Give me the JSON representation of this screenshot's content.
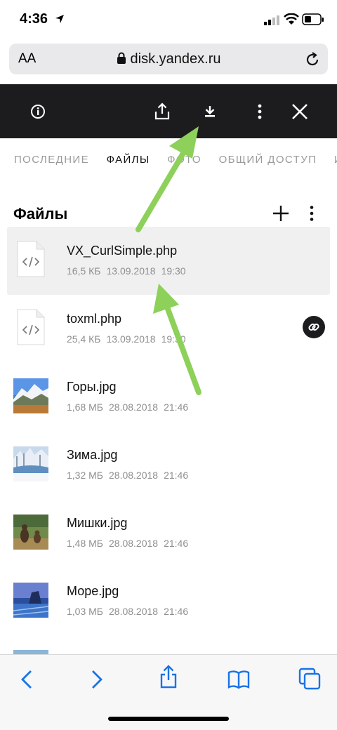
{
  "status": {
    "time": "4:36"
  },
  "browser": {
    "aa_label": "AA",
    "domain": "disk.yandex.ru"
  },
  "tabs": [
    "ПОСЛЕДНИЕ",
    "ФАЙЛЫ",
    "ФОТО",
    "ОБЩИЙ ДОСТУП",
    "И"
  ],
  "section": {
    "title": "Файлы"
  },
  "files": [
    {
      "name": "VX_CurlSimple.php",
      "size": "16,5 КБ",
      "date": "13.09.2018",
      "time": "19:30"
    },
    {
      "name": "toxml.php",
      "size": "25,4 КБ",
      "date": "13.09.2018",
      "time": "19:30"
    },
    {
      "name": "Горы.jpg",
      "size": "1,68 МБ",
      "date": "28.08.2018",
      "time": "21:46"
    },
    {
      "name": "Зима.jpg",
      "size": "1,32 МБ",
      "date": "28.08.2018",
      "time": "21:46"
    },
    {
      "name": "Мишки.jpg",
      "size": "1,48 МБ",
      "date": "28.08.2018",
      "time": "21:46"
    },
    {
      "name": "Море.jpg",
      "size": "1,03 МБ",
      "date": "28.08.2018",
      "time": "21:46"
    }
  ],
  "icons": {
    "toolbar": [
      "info-icon",
      "share-icon",
      "download-icon",
      "more-vertical-icon",
      "close-icon"
    ],
    "browser": [
      "back-icon",
      "forward-icon",
      "share-icon",
      "bookmarks-icon",
      "tabs-icon"
    ]
  },
  "colors": {
    "toolbar": "#1c1c1e",
    "selected_row": "#f0f0f0",
    "arrow": "#8dd05a",
    "ios_blue": "#1a73e8"
  }
}
